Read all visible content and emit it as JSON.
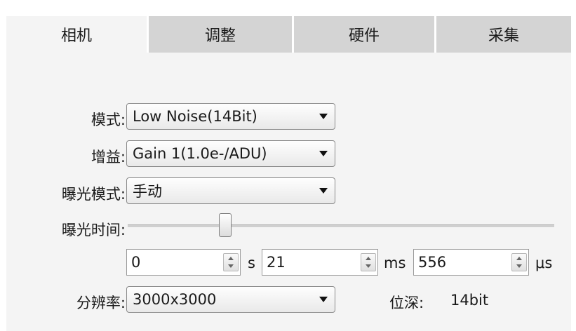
{
  "tabs": [
    {
      "label": "相机",
      "active": true
    },
    {
      "label": "调整",
      "active": false
    },
    {
      "label": "硬件",
      "active": false
    },
    {
      "label": "采集",
      "active": false
    }
  ],
  "camera": {
    "mode": {
      "label": "模式:",
      "value": "Low Noise(14Bit)"
    },
    "gain": {
      "label": "增益:",
      "value": "Gain 1(1.0e-/ADU)"
    },
    "exposure_mode": {
      "label": "曝光模式:",
      "value": "手动"
    },
    "exposure_time": {
      "label": "曝光时间:",
      "seconds": "0",
      "seconds_unit": "s",
      "milliseconds": "21",
      "milliseconds_unit": "ms",
      "microseconds": "556",
      "microseconds_unit": "μs"
    },
    "resolution": {
      "label": "分辨率:",
      "value": "3000x3000"
    },
    "bit_depth": {
      "label": "位深:",
      "value": "14bit"
    }
  },
  "colors": {
    "tab_inactive": "#d4d4d4",
    "panel": "#f4f4f4"
  }
}
